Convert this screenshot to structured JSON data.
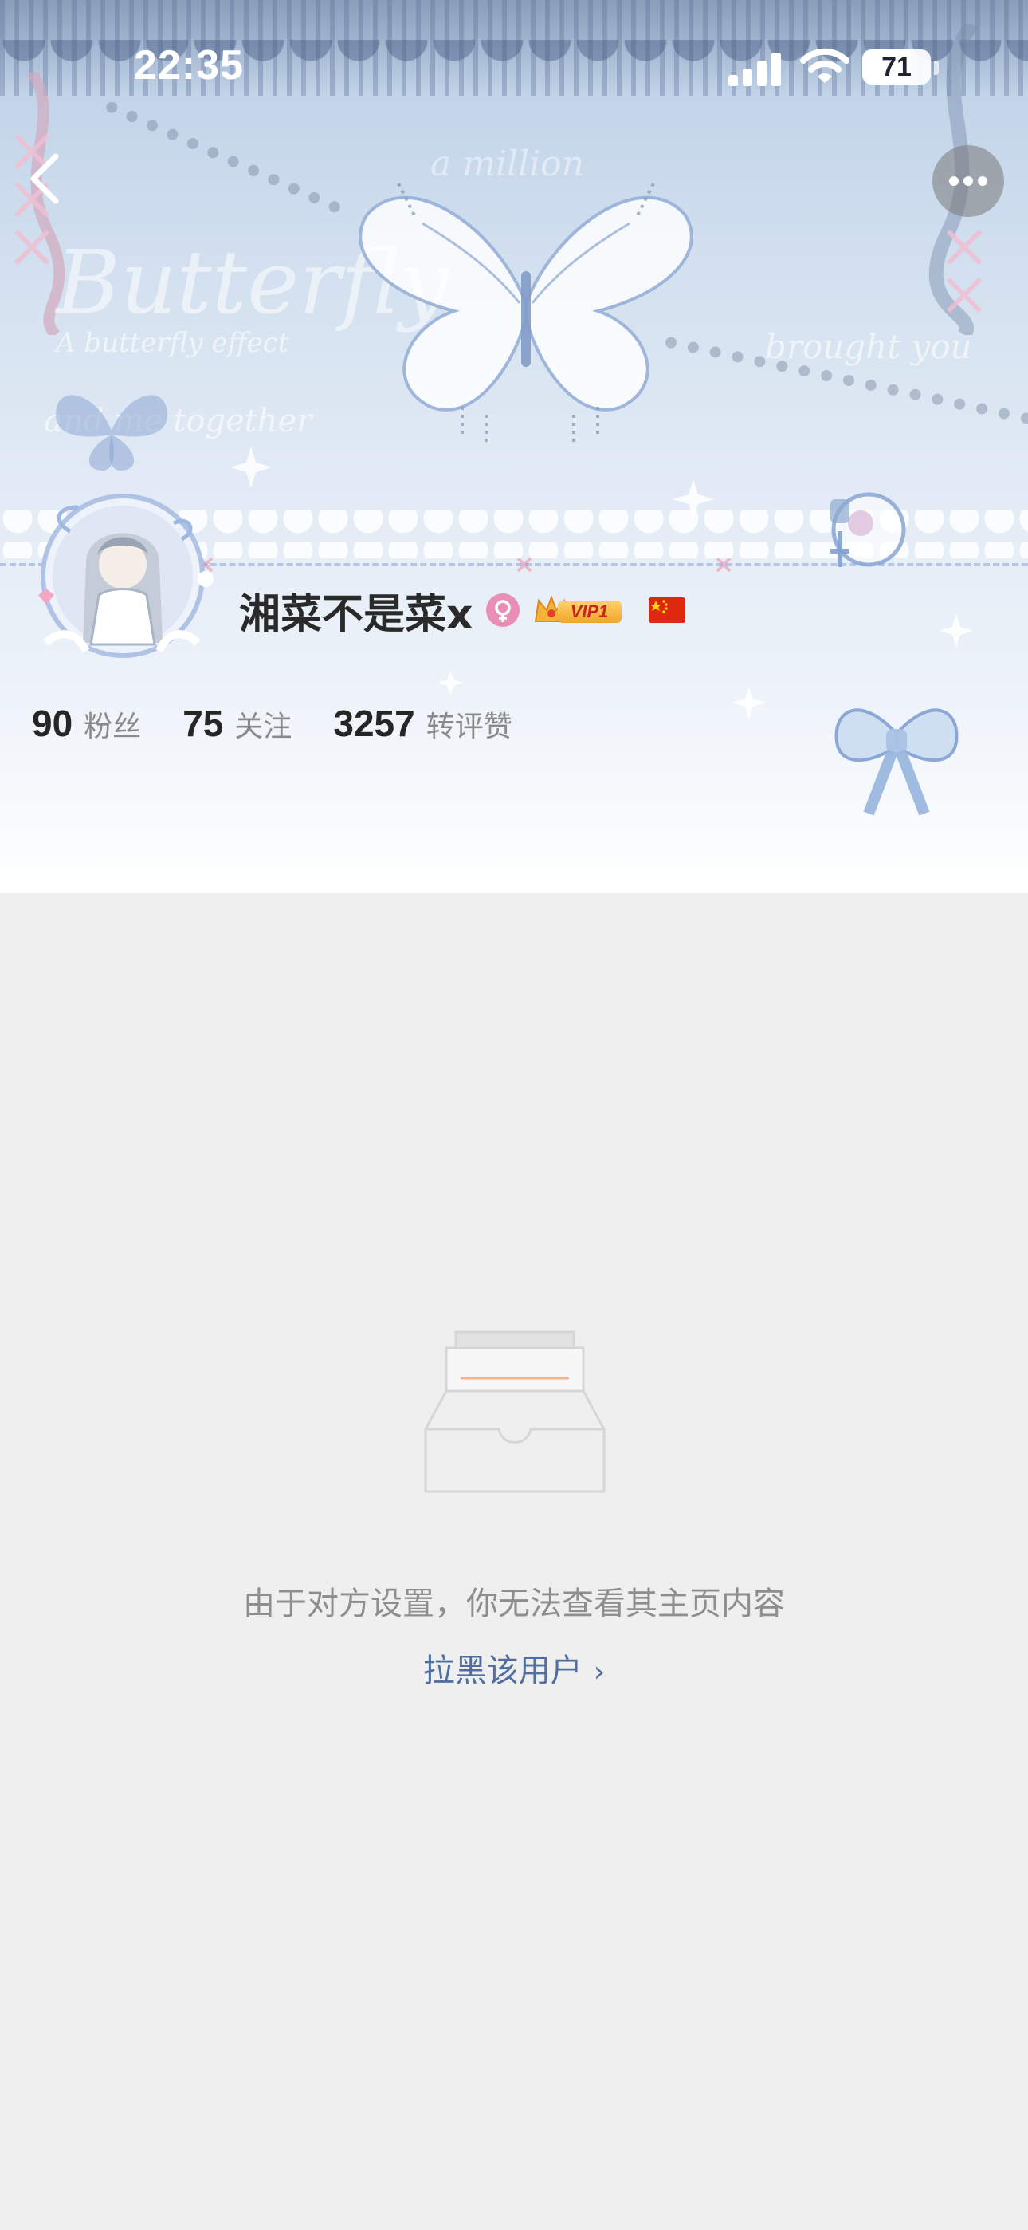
{
  "status_bar": {
    "time": "22:35",
    "battery_percent": "71",
    "battery_level": 0.71
  },
  "header": {
    "background_decoration_text": {
      "line1": "Butterfly",
      "line2": "A butterfly effect",
      "line3": "and me together",
      "line4": "brought you",
      "line5": "a million"
    },
    "colors": {
      "background_top": "#b9cde3",
      "background_bottom": "#ffffff"
    }
  },
  "navigation": {
    "back_icon": "chevron-left-icon",
    "more_icon": "more-horizontal-icon"
  },
  "profile": {
    "username": "湘菜不是菜x",
    "gender": "female",
    "vip_label": "VIP1",
    "region_flag": "china-flag",
    "colors": {
      "gender_badge": "#e98fb6",
      "vip_text": "#c5271c"
    },
    "stats": [
      {
        "value": "90",
        "label": "粉丝"
      },
      {
        "value": "75",
        "label": "关注"
      },
      {
        "value": "3257",
        "label": "转评赞"
      }
    ]
  },
  "content": {
    "empty_icon": "empty-inbox-icon",
    "restricted_message": "由于对方设置，你无法查看其主页内容",
    "block_link_label": "拉黑该用户",
    "block_link_chevron": "›",
    "colors": {
      "background": "#efefef",
      "link": "#4f6fa0"
    }
  }
}
